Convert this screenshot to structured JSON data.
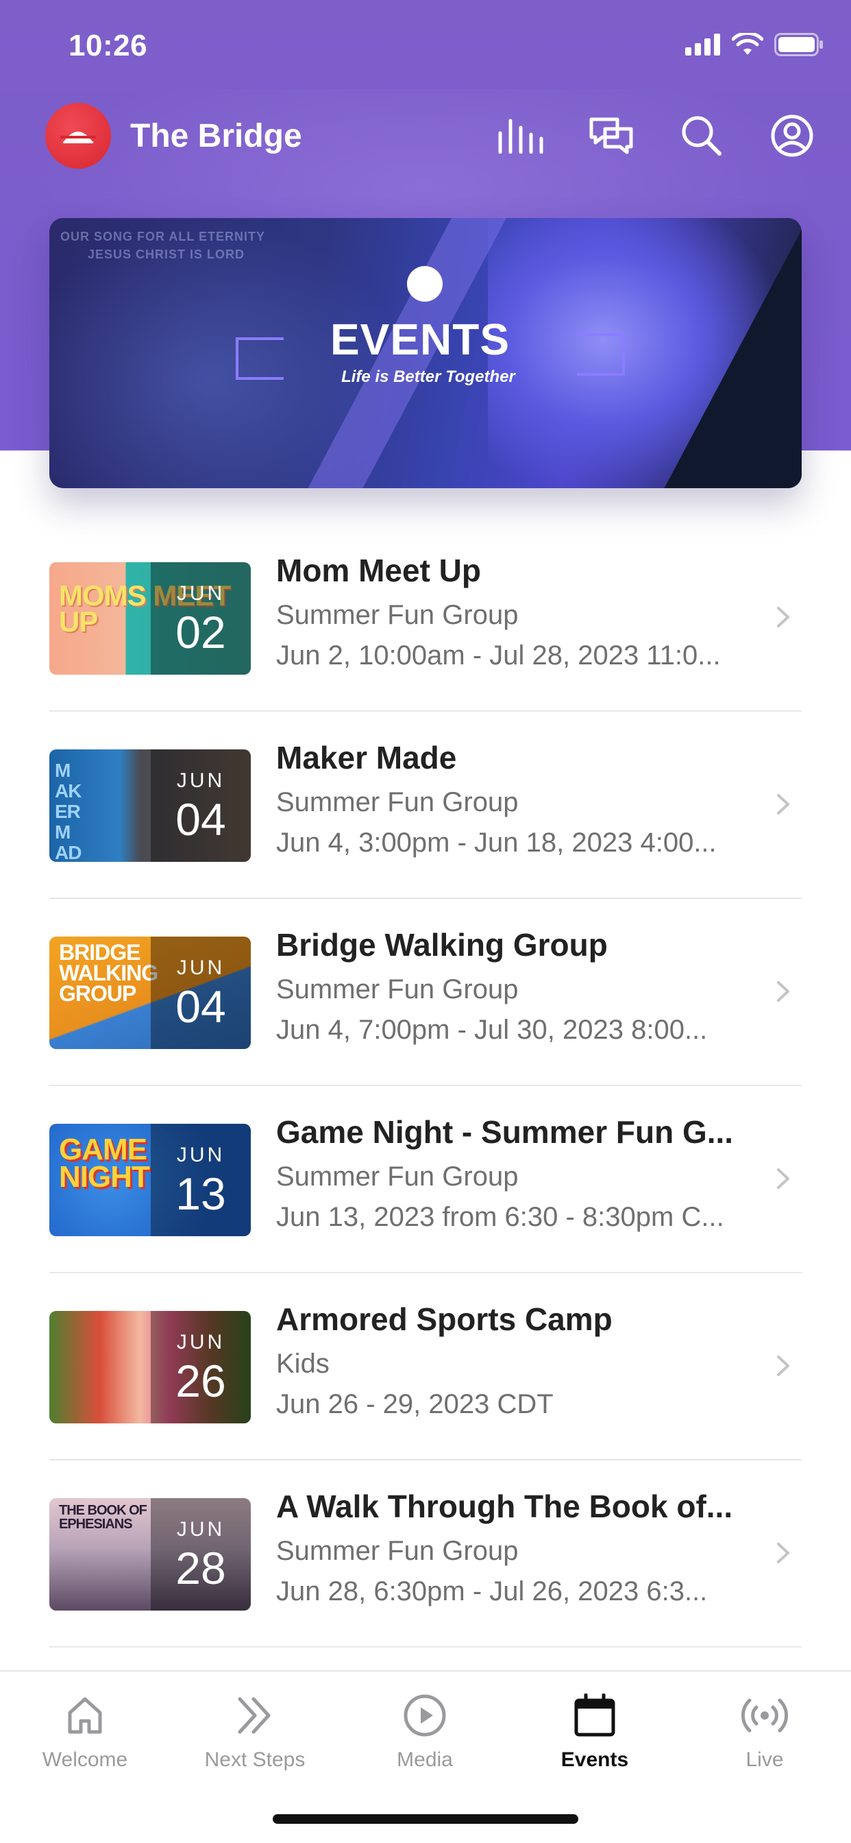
{
  "status_bar": {
    "time": "10:26"
  },
  "app_bar": {
    "title": "The Bridge",
    "icons": [
      "equalizer-icon",
      "chat-icon",
      "search-icon",
      "profile-icon"
    ]
  },
  "banner": {
    "lyric_line1": "OUR SONG FOR ALL ETERNITY",
    "lyric_line2": "JESUS CHRIST IS LORD",
    "title": "EVENTS",
    "subtitle": "Life is Better Together"
  },
  "events": [
    {
      "title": "Mom Meet Up",
      "group": "Summer Fun Group",
      "when": "Jun 2, 10:00am - Jul 28, 2023 11:0...",
      "month": "JUN",
      "day": "02",
      "thumb_text": "MOMS MEET UP",
      "thumb_color": "#f6b08a"
    },
    {
      "title": "Maker Made",
      "group": "Summer Fun Group",
      "when": "Jun 4, 3:00pm - Jun 18, 2023 4:00...",
      "month": "JUN",
      "day": "04",
      "thumb_text": "MAKER MADE",
      "thumb_color": "#1b6fb0"
    },
    {
      "title": "Bridge Walking Group",
      "group": "Summer Fun Group",
      "when": "Jun 4, 7:00pm - Jul 30, 2023 8:00...",
      "month": "JUN",
      "day": "04",
      "thumb_text": "BRIDGE WALKING GROUP",
      "thumb_color": "#f0a024"
    },
    {
      "title": "Game Night - Summer Fun G...",
      "group": "Summer Fun Group",
      "when": "Jun 13, 2023 from 6:30 - 8:30pm C...",
      "month": "JUN",
      "day": "13",
      "thumb_text": "GAME NIGHT",
      "thumb_color": "#1f6fd0"
    },
    {
      "title": "Armored Sports Camp",
      "group": "Kids",
      "when": "Jun 26 - 29, 2023 CDT",
      "month": "JUN",
      "day": "26",
      "thumb_text": "",
      "thumb_color": "#5e8f3a"
    },
    {
      "title": "A Walk Through The Book of...",
      "group": "Summer Fun Group",
      "when": "Jun 28, 6:30pm - Jul 26, 2023 6:3...",
      "month": "JUN",
      "day": "28",
      "thumb_text": "THE BOOK OF EPHESIANS",
      "thumb_color": "#b7a3b8"
    }
  ],
  "tabs": [
    {
      "label": "Welcome",
      "icon": "home-icon",
      "active": false
    },
    {
      "label": "Next Steps",
      "icon": "double-chevron-icon",
      "active": false
    },
    {
      "label": "Media",
      "icon": "play-circle-icon",
      "active": false
    },
    {
      "label": "Events",
      "icon": "calendar-icon",
      "active": true
    },
    {
      "label": "Live",
      "icon": "broadcast-icon",
      "active": false
    }
  ],
  "colors": {
    "header": "#7b5cce",
    "brand_logo": "#e0303a",
    "muted_text": "#6f6f6f",
    "active_tab": "#111111"
  }
}
